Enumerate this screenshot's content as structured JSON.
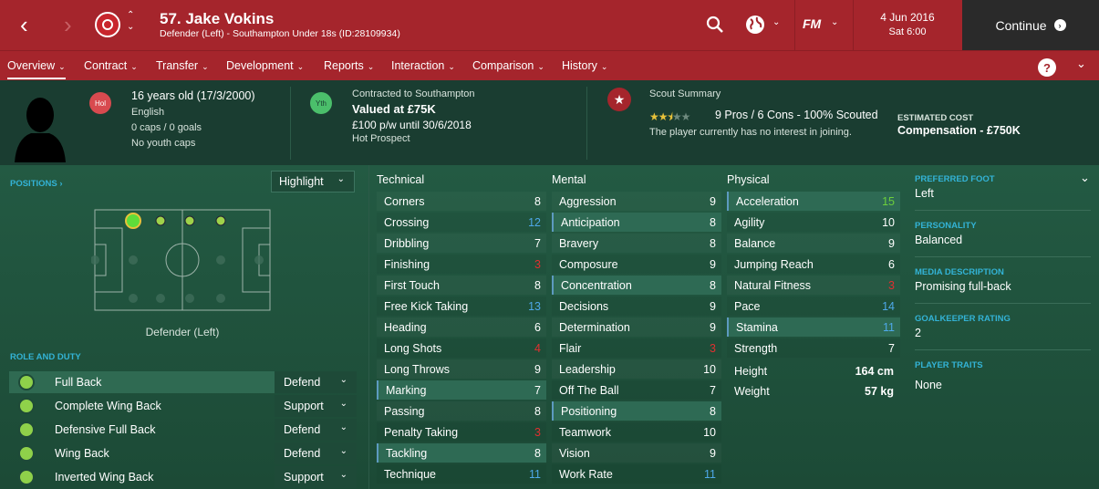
{
  "header": {
    "player_name": "57. Jake Vokins",
    "player_subtitle": "Defender (Left) - Southampton Under 18s (ID:28109934)",
    "date": "4 Jun 2016",
    "time": "Sat 6:00",
    "continue_label": "Continue",
    "fm_label": "FM"
  },
  "tabs": [
    {
      "label": "Overview"
    },
    {
      "label": "Contract"
    },
    {
      "label": "Transfer"
    },
    {
      "label": "Development"
    },
    {
      "label": "Reports"
    },
    {
      "label": "Interaction"
    },
    {
      "label": "Comparison"
    },
    {
      "label": "History"
    }
  ],
  "summary": {
    "badge_hol": "Hol",
    "age": "16 years old (17/3/2000)",
    "nationality": "English",
    "caps": "0 caps / 0 goals",
    "youth_caps": "No youth caps",
    "badge_yth": "Yth",
    "contracted": "Contracted to Southampton",
    "value": "Valued at £75K",
    "wage": "£100 p/w until 30/6/2018",
    "tag": "Hot Prospect",
    "scout_title": "Scout Summary",
    "scout_stars": 2.5,
    "scout_stats": "9 Pros / 6 Cons - 100% Scouted",
    "scout_interest": "The player currently has no interest in joining.",
    "est_cost_label": "ESTIMATED COST",
    "est_cost_value": "Compensation - £750K"
  },
  "positions": {
    "label": "POSITIONS",
    "highlight_label": "Highlight",
    "position_name": "Defender (Left)"
  },
  "role_duty": {
    "label": "ROLE AND DUTY",
    "roles": [
      {
        "name": "Full Back",
        "duty": "Defend"
      },
      {
        "name": "Complete Wing Back",
        "duty": "Support"
      },
      {
        "name": "Defensive Full Back",
        "duty": "Defend"
      },
      {
        "name": "Wing Back",
        "duty": "Defend"
      },
      {
        "name": "Inverted Wing Back",
        "duty": "Support"
      }
    ]
  },
  "attributes": {
    "technical_label": "Technical",
    "mental_label": "Mental",
    "physical_label": "Physical",
    "technical": [
      {
        "name": "Corners",
        "value": "8"
      },
      {
        "name": "Crossing",
        "value": "12"
      },
      {
        "name": "Dribbling",
        "value": "7"
      },
      {
        "name": "Finishing",
        "value": "3"
      },
      {
        "name": "First Touch",
        "value": "8"
      },
      {
        "name": "Free Kick Taking",
        "value": "13"
      },
      {
        "name": "Heading",
        "value": "6"
      },
      {
        "name": "Long Shots",
        "value": "4"
      },
      {
        "name": "Long Throws",
        "value": "9"
      },
      {
        "name": "Marking",
        "value": "7"
      },
      {
        "name": "Passing",
        "value": "8"
      },
      {
        "name": "Penalty Taking",
        "value": "3"
      },
      {
        "name": "Tackling",
        "value": "8"
      },
      {
        "name": "Technique",
        "value": "11"
      }
    ],
    "mental": [
      {
        "name": "Aggression",
        "value": "9"
      },
      {
        "name": "Anticipation",
        "value": "8"
      },
      {
        "name": "Bravery",
        "value": "8"
      },
      {
        "name": "Composure",
        "value": "9"
      },
      {
        "name": "Concentration",
        "value": "8"
      },
      {
        "name": "Decisions",
        "value": "9"
      },
      {
        "name": "Determination",
        "value": "9"
      },
      {
        "name": "Flair",
        "value": "3"
      },
      {
        "name": "Leadership",
        "value": "10"
      },
      {
        "name": "Off The Ball",
        "value": "7"
      },
      {
        "name": "Positioning",
        "value": "8"
      },
      {
        "name": "Teamwork",
        "value": "10"
      },
      {
        "name": "Vision",
        "value": "9"
      },
      {
        "name": "Work Rate",
        "value": "11"
      }
    ],
    "physical": [
      {
        "name": "Acceleration",
        "value": "15"
      },
      {
        "name": "Agility",
        "value": "10"
      },
      {
        "name": "Balance",
        "value": "9"
      },
      {
        "name": "Jumping Reach",
        "value": "6"
      },
      {
        "name": "Natural Fitness",
        "value": "3"
      },
      {
        "name": "Pace",
        "value": "14"
      },
      {
        "name": "Stamina",
        "value": "11"
      },
      {
        "name": "Strength",
        "value": "7"
      }
    ],
    "height_label": "Height",
    "height_value": "164 cm",
    "weight_label": "Weight",
    "weight_value": "57 kg"
  },
  "profile": {
    "preferred_foot_label": "PREFERRED FOOT",
    "preferred_foot": "Left",
    "personality_label": "PERSONALITY",
    "personality": "Balanced",
    "media_label": "MEDIA DESCRIPTION",
    "media": "Promising full-back",
    "gk_label": "GOALKEEPER RATING",
    "gk": "2",
    "traits_label": "PLAYER TRAITS",
    "traits": "None"
  },
  "colors": {
    "header": "#a5252c",
    "continue_bg": "#2a2a2a",
    "value_white": "#ffffff",
    "value_blue": "#4ea8e8",
    "value_red": "#e03030",
    "value_green": "#6ccf3c",
    "accent_teal": "#33b3d6"
  }
}
